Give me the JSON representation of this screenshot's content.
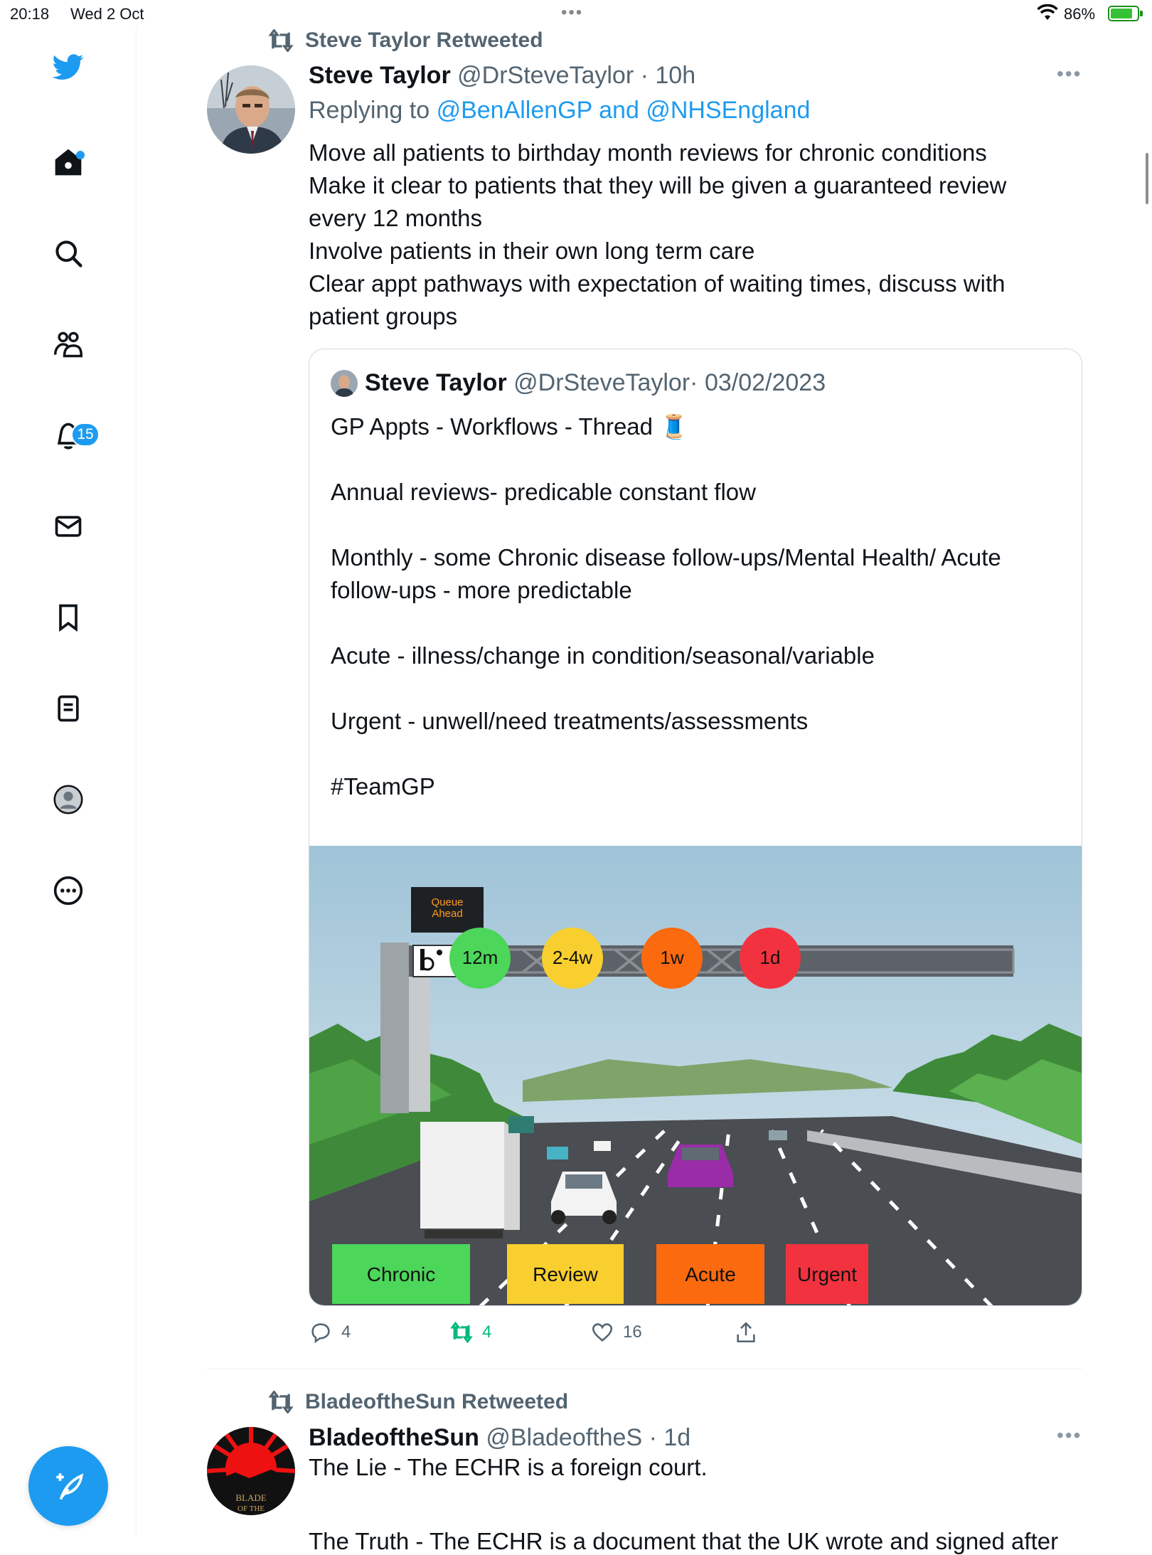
{
  "status_bar": {
    "time": "20:18",
    "date": "Wed 2 Oct",
    "battery": "86%"
  },
  "sidebar": {
    "notifications_badge": "15"
  },
  "tweet1": {
    "retweeted_by": "Steve Taylor Retweeted",
    "name": "Steve Taylor",
    "handle": "@DrSteveTaylor",
    "time": "· 10h",
    "replying_label": "Replying to",
    "reply_user1": "@BenAllenGP",
    "reply_and": "and",
    "reply_user2": "@NHSEngland",
    "body_lines": [
      "Move all patients to birthday month reviews for chronic conditions",
      "Make it clear to patients that they will be given a guaranteed review",
      "every 12 months",
      "Involve patients in their own long term care",
      "Clear appt pathways with expectation of waiting times, discuss with",
      "patient groups"
    ],
    "quote": {
      "name": "Steve Taylor",
      "handle": "@DrSteveTaylor",
      "date": "· 03/02/2023",
      "line1": "GP Appts - Workflows - Thread 🧵",
      "line2": "Annual reviews- predicable constant flow",
      "line3a": "Monthly - some Chronic disease follow-ups/Mental Health/ Acute",
      "line3b": "follow-ups - more predictable",
      "line4": "Acute - illness/change in condition/seasonal/variable",
      "line5": "Urgent - unwell/need treatments/assessments",
      "line6": "#TeamGP",
      "image": {
        "sign": "Queue\nAhead",
        "sign_line1": "Queue",
        "sign_line2": "Ahead",
        "circles": [
          {
            "label": "12m",
            "color": "#4cd65a"
          },
          {
            "label": "2-4w",
            "color": "#f9cf2f"
          },
          {
            "label": "1w",
            "color": "#fb6a0e"
          },
          {
            "label": "1d",
            "color": "#f2333f"
          }
        ],
        "lanes": [
          {
            "label": "Chronic",
            "color": "#4cd65a"
          },
          {
            "label": "Review",
            "color": "#f9cf2f"
          },
          {
            "label": "Acute",
            "color": "#fb6a0e"
          },
          {
            "label": "Urgent",
            "color": "#f2333f"
          }
        ]
      }
    },
    "replies": "4",
    "retweets": "4",
    "likes": "16"
  },
  "tweet2": {
    "retweeted_by": "BladeoftheSun Retweeted",
    "name": "BladeoftheSun",
    "handle": "@BladeoftheS",
    "time": "· 1d",
    "body": "The Lie - The ECHR is a foreign court.",
    "body_partial": "The Truth - The ECHR is a document that the UK wrote and signed after"
  },
  "colors": {
    "accent": "#1d9bf0",
    "retweet_green": "#00ba7c",
    "muted": "#536471"
  }
}
